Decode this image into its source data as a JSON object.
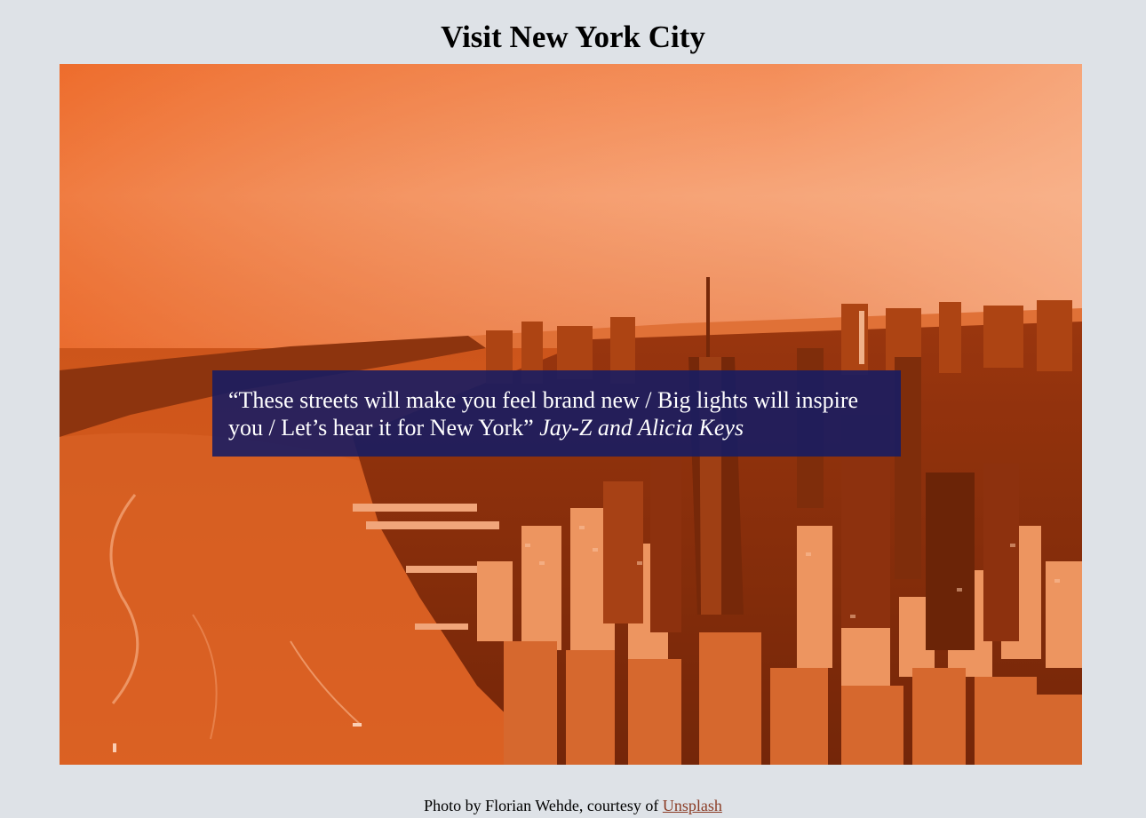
{
  "page": {
    "title": "Visit New York City"
  },
  "hero": {
    "quote_text": "“These streets will make you feel brand new / Big lights will inspire you / Let’s hear it for New York”",
    "quote_author": "Jay-Z and Alicia Keys",
    "tint_color": "#e4621a",
    "quote_box_color": "#141b64"
  },
  "credit": {
    "prefix": "Photo by Florian Wehde, courtesy of ",
    "link_label": "Unsplash",
    "link_color": "#8a3b24"
  }
}
